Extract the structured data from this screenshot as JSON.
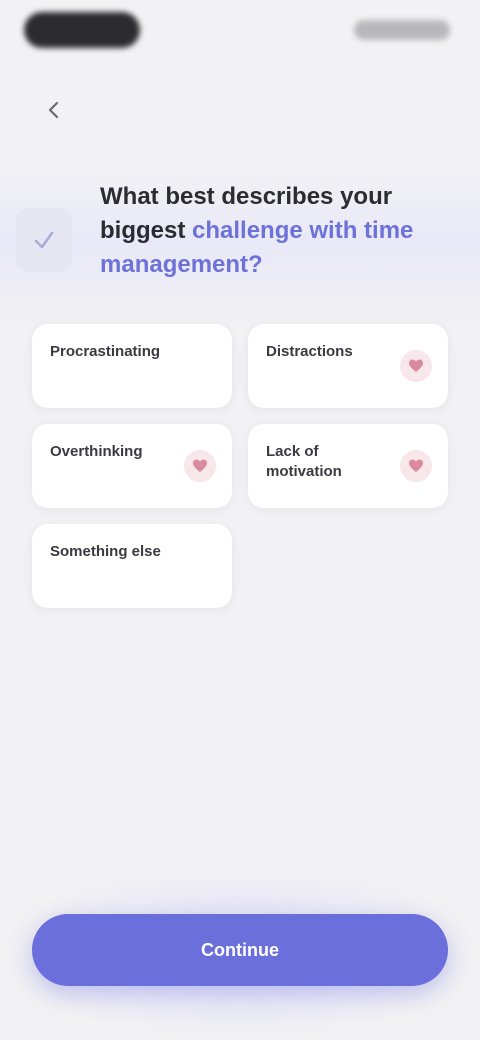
{
  "header": {
    "title_main": "What best describes your biggest",
    "title_highlight": "challenge with time management?"
  },
  "options": [
    {
      "label": "Procrastinating",
      "badge": false
    },
    {
      "label": "Distractions",
      "badge": true
    },
    {
      "label": "Overthinking",
      "badge": true
    },
    {
      "label": "Lack of motivation",
      "badge": true
    },
    {
      "label": "Something else",
      "badge": false
    }
  ],
  "cta": {
    "label": "Continue"
  },
  "colors": {
    "accent": "#6b6fdc",
    "badge_bg": "#f7e6ea",
    "badge_icon": "#d98a9c",
    "background": "#f2f1f3"
  },
  "icons": {
    "back": "chevron-left-icon",
    "header": "checkmark-icon",
    "badge": "heart-icon"
  }
}
